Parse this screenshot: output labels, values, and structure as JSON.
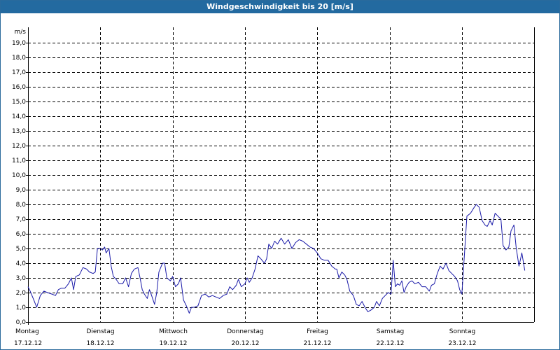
{
  "window": {
    "title": "Windgeschwindigkeit bis 20 [m/s]"
  },
  "colors": {
    "titlebar": "#236aa0",
    "line": "#1a1aa8",
    "grid": "#000000"
  },
  "chart_data": {
    "type": "line",
    "title": "Windgeschwindigkeit bis 20 [m/s]",
    "ylabel": "m/s",
    "ylim": [
      0,
      20
    ],
    "ytick_step": 1,
    "yticks": [
      "0,0",
      "1,0",
      "2,0",
      "3,0",
      "4,0",
      "5,0",
      "6,0",
      "7,0",
      "8,0",
      "9,0",
      "10,0",
      "11,0",
      "12,0",
      "13,0",
      "14,0",
      "15,0",
      "16,0",
      "17,0",
      "18,0",
      "19,0"
    ],
    "xlim": [
      0,
      7
    ],
    "grid": true,
    "days": [
      {
        "name": "Montag",
        "date": "17.12.12"
      },
      {
        "name": "Dienstag",
        "date": "18.12.12"
      },
      {
        "name": "Mittwoch",
        "date": "19.12.12"
      },
      {
        "name": "Donnerstag",
        "date": "20.12.12"
      },
      {
        "name": "Freitag",
        "date": "21.12.12"
      },
      {
        "name": "Samstag",
        "date": "22.12.12"
      },
      {
        "name": "Sonntag",
        "date": "23.12.12"
      }
    ],
    "series": [
      {
        "values": [
          [
            0.0,
            2.4
          ],
          [
            0.03,
            2.1
          ],
          [
            0.08,
            1.5
          ],
          [
            0.12,
            1.0
          ],
          [
            0.17,
            1.8
          ],
          [
            0.22,
            2.1
          ],
          [
            0.27,
            2.0
          ],
          [
            0.33,
            1.9
          ],
          [
            0.38,
            1.8
          ],
          [
            0.42,
            2.2
          ],
          [
            0.46,
            2.3
          ],
          [
            0.51,
            2.3
          ],
          [
            0.56,
            2.6
          ],
          [
            0.6,
            3.0
          ],
          [
            0.63,
            2.2
          ],
          [
            0.66,
            3.1
          ],
          [
            0.71,
            3.2
          ],
          [
            0.76,
            3.7
          ],
          [
            0.81,
            3.6
          ],
          [
            0.85,
            3.4
          ],
          [
            0.9,
            3.3
          ],
          [
            0.93,
            3.4
          ],
          [
            0.96,
            5.0
          ],
          [
            1.0,
            5.0
          ],
          [
            1.03,
            4.9
          ],
          [
            1.06,
            5.1
          ],
          [
            1.08,
            4.7
          ],
          [
            1.12,
            5.0
          ],
          [
            1.15,
            3.8
          ],
          [
            1.18,
            3.1
          ],
          [
            1.22,
            2.9
          ],
          [
            1.26,
            2.6
          ],
          [
            1.31,
            2.6
          ],
          [
            1.35,
            3.0
          ],
          [
            1.39,
            2.4
          ],
          [
            1.43,
            3.3
          ],
          [
            1.47,
            3.6
          ],
          [
            1.52,
            3.7
          ],
          [
            1.55,
            3.0
          ],
          [
            1.58,
            2.2
          ],
          [
            1.61,
            1.9
          ],
          [
            1.65,
            1.6
          ],
          [
            1.68,
            2.2
          ],
          [
            1.71,
            1.8
          ],
          [
            1.75,
            1.2
          ],
          [
            1.78,
            2.0
          ],
          [
            1.81,
            3.4
          ],
          [
            1.86,
            4.0
          ],
          [
            1.89,
            4.0
          ],
          [
            1.92,
            3.0
          ],
          [
            1.97,
            2.8
          ],
          [
            2.0,
            3.1
          ],
          [
            2.04,
            2.4
          ],
          [
            2.08,
            2.6
          ],
          [
            2.11,
            3.0
          ],
          [
            2.15,
            1.5
          ],
          [
            2.19,
            1.1
          ],
          [
            2.23,
            0.6
          ],
          [
            2.26,
            1.0
          ],
          [
            2.3,
            1.0
          ],
          [
            2.35,
            1.1
          ],
          [
            2.4,
            1.8
          ],
          [
            2.45,
            1.9
          ],
          [
            2.5,
            1.7
          ],
          [
            2.55,
            1.8
          ],
          [
            2.6,
            1.7
          ],
          [
            2.65,
            1.6
          ],
          [
            2.7,
            1.8
          ],
          [
            2.75,
            1.9
          ],
          [
            2.79,
            2.4
          ],
          [
            2.83,
            2.2
          ],
          [
            2.88,
            2.5
          ],
          [
            2.91,
            2.9
          ],
          [
            2.95,
            2.4
          ],
          [
            3.0,
            2.6
          ],
          [
            3.03,
            3.0
          ],
          [
            3.06,
            2.7
          ],
          [
            3.1,
            3.0
          ],
          [
            3.14,
            3.6
          ],
          [
            3.18,
            4.5
          ],
          [
            3.22,
            4.3
          ],
          [
            3.27,
            4.0
          ],
          [
            3.3,
            4.3
          ],
          [
            3.33,
            5.3
          ],
          [
            3.37,
            5.0
          ],
          [
            3.41,
            5.5
          ],
          [
            3.45,
            5.3
          ],
          [
            3.5,
            5.7
          ],
          [
            3.55,
            5.3
          ],
          [
            3.6,
            5.6
          ],
          [
            3.65,
            5.0
          ],
          [
            3.7,
            5.4
          ],
          [
            3.75,
            5.6
          ],
          [
            3.8,
            5.5
          ],
          [
            3.85,
            5.3
          ],
          [
            3.9,
            5.1
          ],
          [
            3.95,
            5.0
          ],
          [
            4.0,
            4.7
          ],
          [
            4.05,
            4.3
          ],
          [
            4.1,
            4.2
          ],
          [
            4.15,
            4.2
          ],
          [
            4.2,
            3.8
          ],
          [
            4.25,
            3.6
          ],
          [
            4.27,
            3.6
          ],
          [
            4.3,
            3.0
          ],
          [
            4.34,
            3.4
          ],
          [
            4.38,
            3.2
          ],
          [
            4.41,
            2.9
          ],
          [
            4.45,
            2.1
          ],
          [
            4.5,
            1.8
          ],
          [
            4.54,
            1.2
          ],
          [
            4.58,
            1.1
          ],
          [
            4.62,
            1.4
          ],
          [
            4.66,
            1.0
          ],
          [
            4.7,
            0.7
          ],
          [
            4.74,
            0.8
          ],
          [
            4.79,
            1.0
          ],
          [
            4.82,
            1.4
          ],
          [
            4.86,
            1.1
          ],
          [
            4.9,
            1.6
          ],
          [
            4.94,
            1.8
          ],
          [
            4.98,
            2.0
          ],
          [
            5.02,
            1.9
          ],
          [
            5.05,
            4.2
          ],
          [
            5.08,
            2.4
          ],
          [
            5.11,
            2.6
          ],
          [
            5.14,
            2.5
          ],
          [
            5.17,
            2.8
          ],
          [
            5.2,
            2.0
          ],
          [
            5.23,
            2.4
          ],
          [
            5.27,
            2.7
          ],
          [
            5.31,
            2.8
          ],
          [
            5.35,
            2.6
          ],
          [
            5.4,
            2.7
          ],
          [
            5.45,
            2.4
          ],
          [
            5.5,
            2.4
          ],
          [
            5.55,
            2.1
          ],
          [
            5.58,
            2.5
          ],
          [
            5.62,
            2.6
          ],
          [
            5.66,
            3.3
          ],
          [
            5.7,
            3.8
          ],
          [
            5.74,
            3.6
          ],
          [
            5.78,
            4.0
          ],
          [
            5.82,
            3.5
          ],
          [
            5.86,
            3.3
          ],
          [
            5.9,
            3.1
          ],
          [
            5.94,
            2.8
          ],
          [
            5.97,
            2.2
          ],
          [
            6.0,
            1.9
          ],
          [
            6.04,
            4.9
          ],
          [
            6.07,
            7.2
          ],
          [
            6.12,
            7.4
          ],
          [
            6.17,
            7.8
          ],
          [
            6.2,
            8.0
          ],
          [
            6.24,
            7.8
          ],
          [
            6.28,
            6.9
          ],
          [
            6.32,
            6.6
          ],
          [
            6.35,
            6.5
          ],
          [
            6.39,
            6.9
          ],
          [
            6.42,
            6.6
          ],
          [
            6.46,
            7.4
          ],
          [
            6.5,
            7.2
          ],
          [
            6.54,
            7.0
          ],
          [
            6.57,
            5.2
          ],
          [
            6.61,
            4.9
          ],
          [
            6.65,
            5.1
          ],
          [
            6.68,
            6.2
          ],
          [
            6.72,
            6.6
          ],
          [
            6.75,
            5.1
          ],
          [
            6.79,
            3.8
          ],
          [
            6.83,
            4.7
          ],
          [
            6.87,
            3.5
          ]
        ]
      }
    ]
  }
}
